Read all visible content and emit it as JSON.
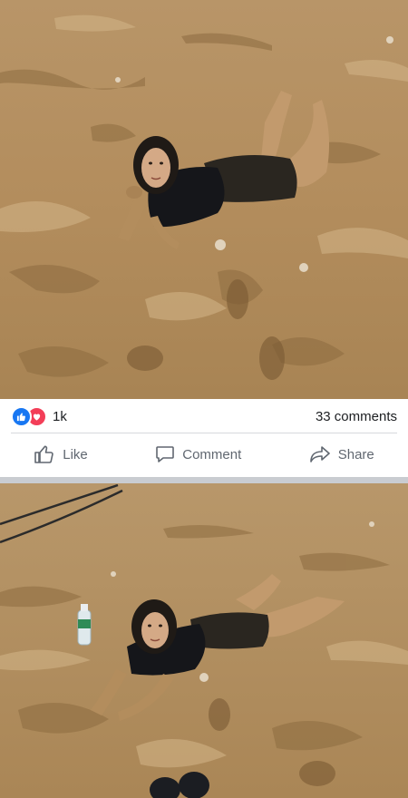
{
  "post_top": {
    "photo": {
      "subject": "person-lying-in-mud-photo"
    },
    "reactions": {
      "icons": [
        "like-icon",
        "love-icon"
      ],
      "count": "1k"
    },
    "comments": {
      "count_label": "33 comments"
    },
    "actions": [
      {
        "label": "Like",
        "icon": "thumbs-up-icon"
      },
      {
        "label": "Comment",
        "icon": "speech-bubble-icon"
      },
      {
        "label": "Share",
        "icon": "share-arrow-icon"
      }
    ]
  },
  "post_bottom": {
    "photo": {
      "subject": "person-lying-in-mud-with-water-bottle-photo"
    }
  },
  "colors": {
    "brand_blue": "#1877f2",
    "love_red": "#f33e58",
    "action_gray": "#606770",
    "mud": "#b4905f"
  }
}
